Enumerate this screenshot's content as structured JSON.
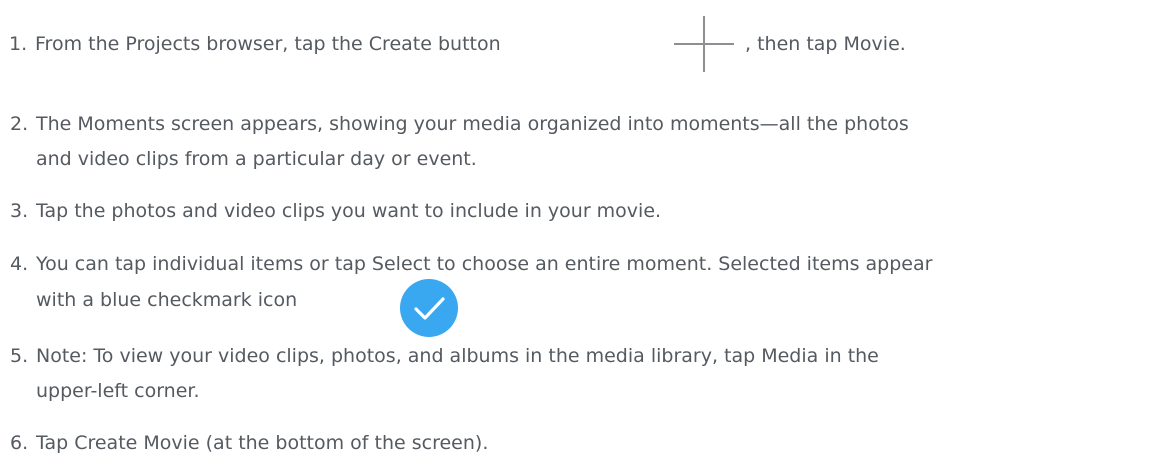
{
  "steps": [
    {
      "num": "1.",
      "text_before": "From the Projects browser, tap the Create button",
      "text_after": ", then tap Movie.",
      "icon": "plus-icon"
    },
    {
      "num": "2.",
      "line1": "The Moments screen appears, showing your media organized into moments—all the photos",
      "line2": "and video clips from a particular day or event."
    },
    {
      "num": "3.",
      "line1": "Tap the photos and video clips you want to include in your movie."
    },
    {
      "num": "4.",
      "line1": "You can tap individual items or tap Select to choose an entire moment. Selected items appear",
      "line2": "with a blue checkmark icon",
      "icon": "checkmark-icon",
      "icon_color": "#3aa8f0"
    },
    {
      "num": "5.",
      "line1": "Note: To view your video clips, photos, and albums in the media library, tap Media in the",
      "line2": "upper-left corner."
    },
    {
      "num": "6.",
      "line1": "Tap Create Movie (at the bottom of the screen)."
    }
  ],
  "colors": {
    "text": "#555a60",
    "plus_icon": "#8e8e93",
    "check_fill": "#3aa8f0"
  }
}
